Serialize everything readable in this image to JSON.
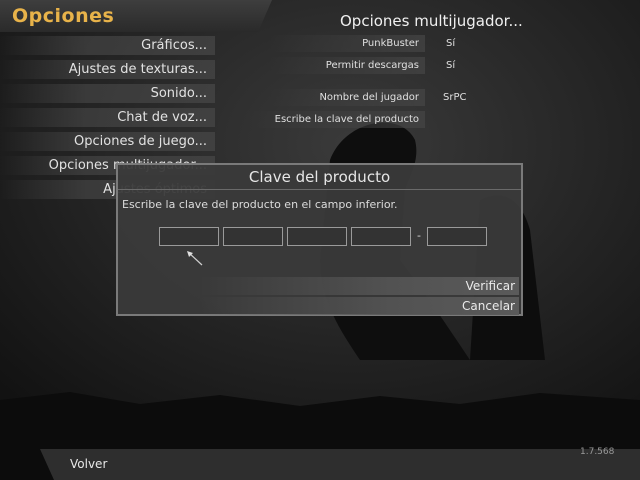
{
  "header": {
    "title": "Opciones"
  },
  "menu": {
    "items": [
      {
        "label": "Gráficos..."
      },
      {
        "label": "Ajustes de texturas..."
      },
      {
        "label": "Sonido..."
      },
      {
        "label": "Chat de voz..."
      },
      {
        "label": "Opciones de juego..."
      },
      {
        "label": "Opciones multijugador..."
      },
      {
        "label": "Ajustes óptimos"
      }
    ]
  },
  "multiplayer": {
    "title": "Opciones multijugador...",
    "options": [
      {
        "label": "PunkBuster",
        "value": "Sí"
      },
      {
        "label": "Permitir descargas",
        "value": "Sí"
      },
      {
        "label": "Nombre del jugador",
        "value": "SrPC"
      },
      {
        "label": "Escribe la clave del producto",
        "value": ""
      }
    ]
  },
  "dialog": {
    "title": "Clave del producto",
    "instruction": "Escribe la clave del producto en el campo inferior.",
    "separator": "-",
    "verify_label": "Verificar",
    "cancel_label": "Cancelar"
  },
  "footer": {
    "back_label": "Volver",
    "version": "1.7.568"
  },
  "colors": {
    "title_accent": "#e8b34a",
    "dialog_border": "#7a7a7a"
  }
}
